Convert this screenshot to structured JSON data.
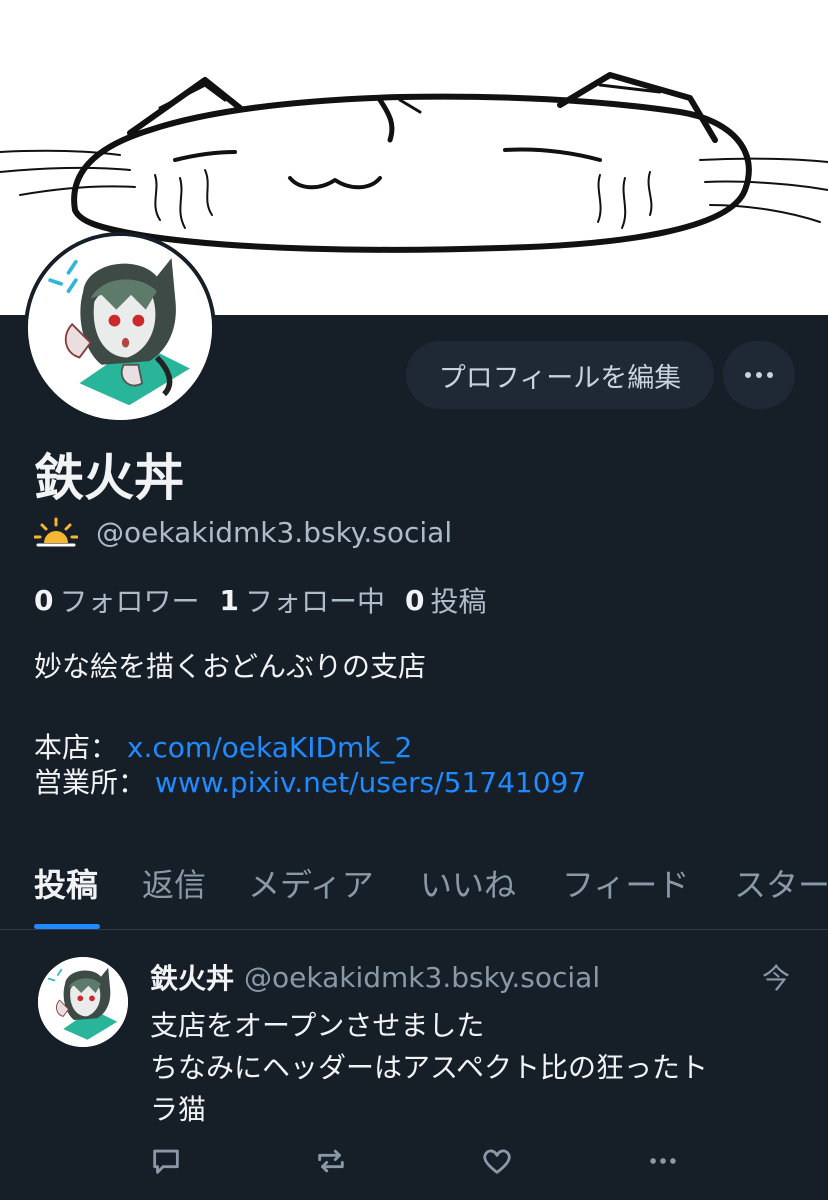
{
  "profile": {
    "display_name": "鉄火丼",
    "handle": "@oekakidmk3.bsky.social",
    "edit_label": "プロフィールを編集",
    "stats": [
      {
        "count": "0",
        "label": "フォロワー"
      },
      {
        "count": "1",
        "label": "フォロー中"
      },
      {
        "count": "0",
        "label": "投稿"
      }
    ],
    "bio": "妙な絵を描くおどんぶりの支店",
    "links": [
      {
        "label": "本店：",
        "url": "x.com/oekaKIDmk_2"
      },
      {
        "label": "営業所：",
        "url": "www.pixiv.net/users/51741097"
      }
    ]
  },
  "tabs": [
    "投稿",
    "返信",
    "メディア",
    "いいね",
    "フィード",
    "スター"
  ],
  "post": {
    "author_name": "鉄火丼",
    "author_handle": "@oekakidmk3.bsky.social",
    "time": "今",
    "lines": [
      "支店をオープンさせました",
      "ちなみにヘッダーはアスペクト比の狂ったト",
      "ラ猫"
    ]
  },
  "colors": {
    "background": "#161e27",
    "accent": "#208bfe",
    "button_bg": "#1e2935"
  }
}
